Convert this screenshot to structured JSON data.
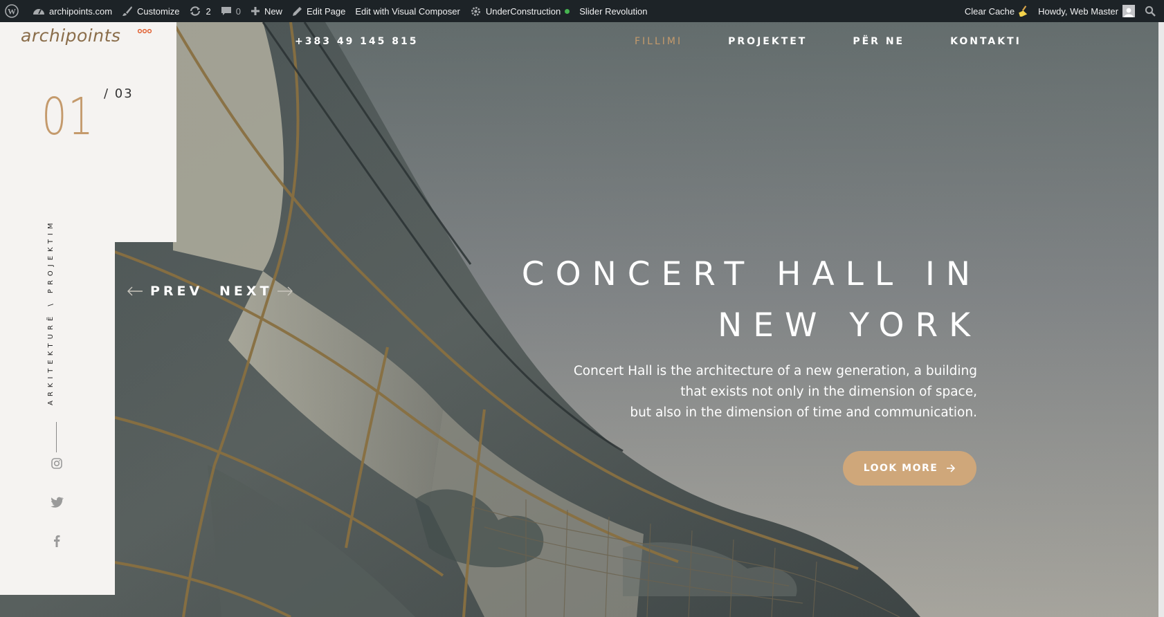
{
  "adminbar": {
    "site_name": "archipoints.com",
    "customize": "Customize",
    "updates_count": "2",
    "comments_count": "0",
    "new": "New",
    "edit_page": "Edit Page",
    "visual_composer": "Edit with Visual Composer",
    "under_construction": "UnderConstruction",
    "slider_revolution": "Slider Revolution",
    "clear_cache": "Clear Cache",
    "howdy": "Howdy, Web Master"
  },
  "brand": {
    "logo_text": "archipoints",
    "accent_color": "#c49a6c"
  },
  "slider": {
    "current": "01",
    "total": "/  03",
    "category": "ARKITEKTURË  \\  PROJEKTIM",
    "prev": "PREV",
    "next": "NEXT",
    "title": "CONCERT HALL IN NEW YORK",
    "description": [
      "Concert Hall is the architecture of a new generation, a building",
      "that exists not only in the dimension of space,",
      "but also in the dimension of time and communication."
    ],
    "cta": "LOOK MORE"
  },
  "header": {
    "phone": "+383 49 145 815",
    "nav": [
      "FILLIMI",
      "PROJEKTET",
      "PËR NE",
      "KONTAKTI"
    ],
    "active_nav": "FILLIMI"
  },
  "social": [
    "instagram-icon",
    "twitter-icon",
    "facebook-icon"
  ]
}
